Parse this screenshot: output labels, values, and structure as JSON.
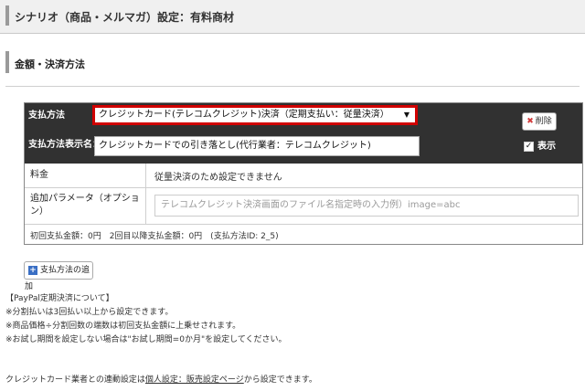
{
  "page": {
    "title": "シナリオ（商品・メルマガ）設定：有料商材"
  },
  "section": {
    "title": "金額・決済方法"
  },
  "panel": {
    "payment_method_label": "支払方法",
    "payment_method_value": "クレジットカード(テレコムクレジット)決済（定期支払い：従量決済）",
    "payment_display_label": "支払方法表示名：",
    "payment_display_value": "クレジットカードでの引き落とし(代行業者：テレコムクレジット)",
    "delete_label": "削除",
    "show_label": "表示",
    "price_label": "料金",
    "price_value": "従量決済のため設定できません",
    "param_label": "追加パラメータ（オプション）",
    "param_placeholder": "テレコムクレジット決済画面のファイル名指定時の入力例）image=abc",
    "summary": "初回支払金額：0円　2回目以降支払金額：0円　(支払方法ID: 2_5)"
  },
  "add_button": {
    "label": "支払方法の追加"
  },
  "notes": [
    "【PayPal定期決済について】",
    "※分割払いは3回払い以上から設定できます。",
    "※商品価格÷分割回数の端数は初回支払金額に上乗せされます。",
    "※お試し期間を設定しない場合は\"お試し期間=0か月\"を設定してください。"
  ],
  "footer": {
    "prefix": "クレジットカード業者との連動設定は",
    "link": "個人設定：販売設定ページ",
    "suffix": "から設定できます。"
  },
  "colors": {
    "header_bg": "#f0f0f0",
    "panel_dark": "#313131",
    "select_border": "#d00000",
    "plus_icon": "#3a6fc4"
  },
  "icons": {
    "delete": "close-icon",
    "add": "plus-icon",
    "checkbox": "checkmark-icon"
  }
}
